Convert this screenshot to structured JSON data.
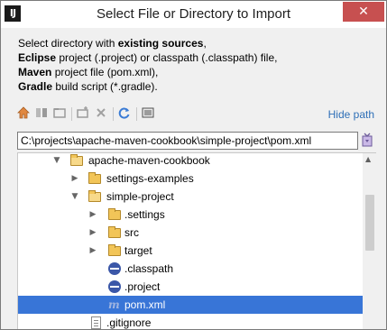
{
  "window": {
    "title": "Select File or Directory to Import",
    "app_icon_text": "IJ",
    "close_glyph": "✕"
  },
  "description": {
    "line1_prefix": "Select directory with ",
    "line1_bold": "existing sources",
    "line1_suffix": ",",
    "line2_bold": "Eclipse",
    "line2_rest": " project (.project) or classpath (.classpath) file,",
    "line3_bold": "Maven",
    "line3_rest": " project file (pom.xml),",
    "line4_bold": "Gradle",
    "line4_rest": " build script (*.gradle)."
  },
  "toolbar": {
    "icons": [
      "home-icon",
      "project-icon",
      "new-folder-icon",
      "delete-folder-icon",
      "delete-icon",
      "refresh-icon",
      "show-hidden-icon"
    ],
    "hide_path_label": "Hide path"
  },
  "path": {
    "value": "C:\\projects\\apache-maven-cookbook\\simple-project\\pom.xml"
  },
  "tree": {
    "items": [
      {
        "label": "apache-maven-cookbook",
        "type": "folder",
        "expanded": true
      },
      {
        "label": "settings-examples",
        "type": "folder",
        "expanded": false
      },
      {
        "label": "simple-project",
        "type": "folder",
        "expanded": true
      },
      {
        "label": ".settings",
        "type": "folder",
        "expanded": false
      },
      {
        "label": "src",
        "type": "folder",
        "expanded": false
      },
      {
        "label": "target",
        "type": "folder",
        "expanded": false
      },
      {
        "label": ".classpath",
        "type": "eclipse-file"
      },
      {
        "label": ".project",
        "type": "eclipse-file"
      },
      {
        "label": "pom.xml",
        "type": "maven-file",
        "selected": true
      },
      {
        "label": ".gitignore",
        "type": "text-file"
      }
    ]
  },
  "colors": {
    "selection": "#3875d7",
    "link": "#2e6fb7",
    "close": "#c75050",
    "folder": "#f2c558"
  }
}
